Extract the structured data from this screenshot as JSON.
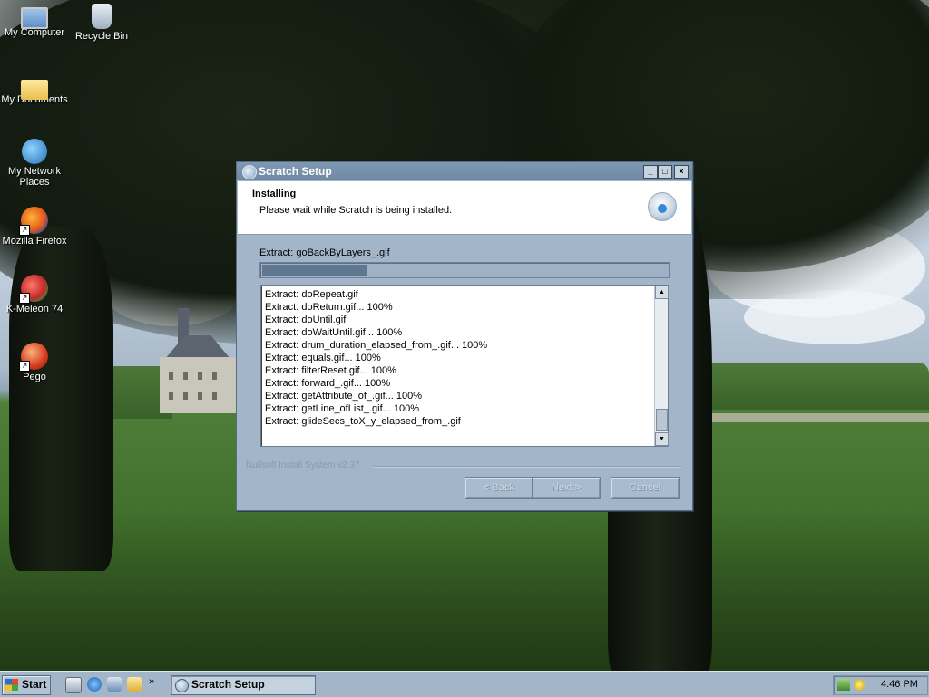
{
  "desktop": {
    "icons": [
      {
        "label": "My Computer",
        "icon": "my-computer-icon"
      },
      {
        "label": "Recycle Bin",
        "icon": "recycle-bin-icon"
      },
      {
        "label": "My Documents",
        "icon": "my-documents-icon"
      },
      {
        "label": "My Network Places",
        "icon": "network-places-icon"
      },
      {
        "label": "Mozilla Firefox",
        "icon": "firefox-icon"
      },
      {
        "label": "K-Meleon 74",
        "icon": "kmeleon-icon"
      },
      {
        "label": "Pego",
        "icon": "pego-icon"
      }
    ]
  },
  "dialog": {
    "title": "Scratch Setup",
    "header_title": "Installing",
    "header_subtitle": "Please wait while Scratch is being installed.",
    "current_status": "Extract: goBackByLayers_.gif",
    "progress_fraction": 0.26,
    "log_lines": [
      "Extract: doRepeat.gif",
      "Extract: doReturn.gif... 100%",
      "Extract: doUntil.gif",
      "Extract: doWaitUntil.gif... 100%",
      "Extract: drum_duration_elapsed_from_.gif... 100%",
      "Extract: equals.gif... 100%",
      "Extract: filterReset.gif... 100%",
      "Extract: forward_.gif... 100%",
      "Extract: getAttribute_of_.gif... 100%",
      "Extract: getLine_ofList_.gif... 100%",
      "Extract: glideSecs_toX_y_elapsed_from_.gif"
    ],
    "branding": "Nullsoft Install System v2.37",
    "buttons": {
      "back": "< Back",
      "next": "Next >",
      "cancel": "Cancel"
    },
    "title_buttons": {
      "minimize": "_",
      "maximize": "□",
      "close": "×"
    },
    "scroll_up": "▲",
    "scroll_down": "▼"
  },
  "taskbar": {
    "start_label": "Start",
    "quick_launch": [
      "show-desktop-icon",
      "internet-explorer-icon",
      "outlook-express-icon",
      "explorer-icon"
    ],
    "chevron": "»",
    "task_label": "Scratch Setup",
    "clock": "4:46 PM"
  }
}
